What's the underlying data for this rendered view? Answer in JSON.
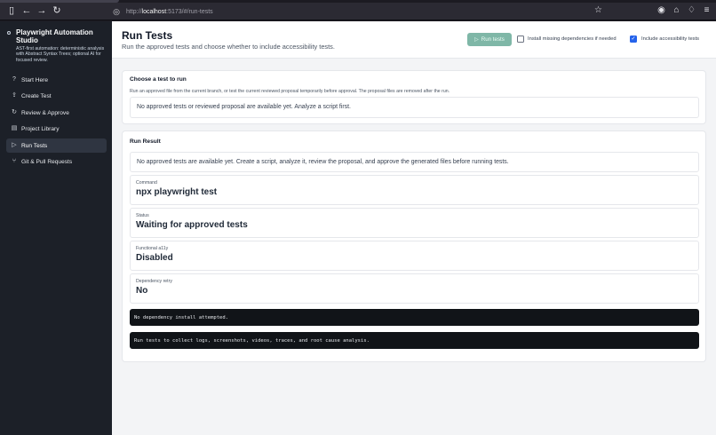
{
  "browser": {
    "url_prefix": "http://",
    "url_host": "localhost",
    "url_rest": ":5173/#/run-tests"
  },
  "sidebar": {
    "app_title": "Playwright Automation Studio",
    "app_desc": "AST-first automation: deterministic analysis with Abstract Syntax Trees; optional AI for focused review.",
    "items": [
      {
        "label": "Start Here",
        "icon": "help-circle-icon"
      },
      {
        "label": "Create Test",
        "icon": "upload-icon"
      },
      {
        "label": "Review & Approve",
        "icon": "refresh-icon"
      },
      {
        "label": "Project Library",
        "icon": "file-icon"
      },
      {
        "label": "Run Tests",
        "icon": "play-icon"
      },
      {
        "label": "Git & Pull Requests",
        "icon": "git-branch-icon"
      }
    ],
    "active_item": "Run Tests"
  },
  "header": {
    "title": "Run Tests",
    "subtitle": "Run the approved tests and choose whether to include accessibility tests.",
    "run_button": "Run tests",
    "install_deps_label": "Install missing dependencies if needed",
    "install_deps_checked": false,
    "a11y_label": "Include accessibility tests",
    "a11y_checked": true
  },
  "choose": {
    "title": "Choose a test to run",
    "hint": "Run an approved file from the current branch, or test the current reviewed proposal temporarily before approval. The proposal files are removed after the run.",
    "empty": "No approved tests or reviewed proposal are available yet. Analyze a script first."
  },
  "result": {
    "title": "Run Result",
    "message": "No approved tests are available yet. Create a script, analyze it, review the proposal, and approve the generated files before running tests.",
    "fields": [
      {
        "label": "Command",
        "value": "npx playwright test"
      },
      {
        "label": "Status",
        "value": "Waiting for approved tests"
      },
      {
        "label": "Functional a11y",
        "value": "Disabled"
      },
      {
        "label": "Dependency retry",
        "value": "No"
      }
    ],
    "log1": "No dependency install attempted.",
    "log2": "Run tests to collect logs, screenshots, videos, traces, and root cause analysis."
  },
  "colors": {
    "sidebar_bg": "#1c2028",
    "run_button_bg": "#7fb7a7",
    "checkbox_accent": "#2563eb",
    "terminal_bg": "#111418"
  }
}
